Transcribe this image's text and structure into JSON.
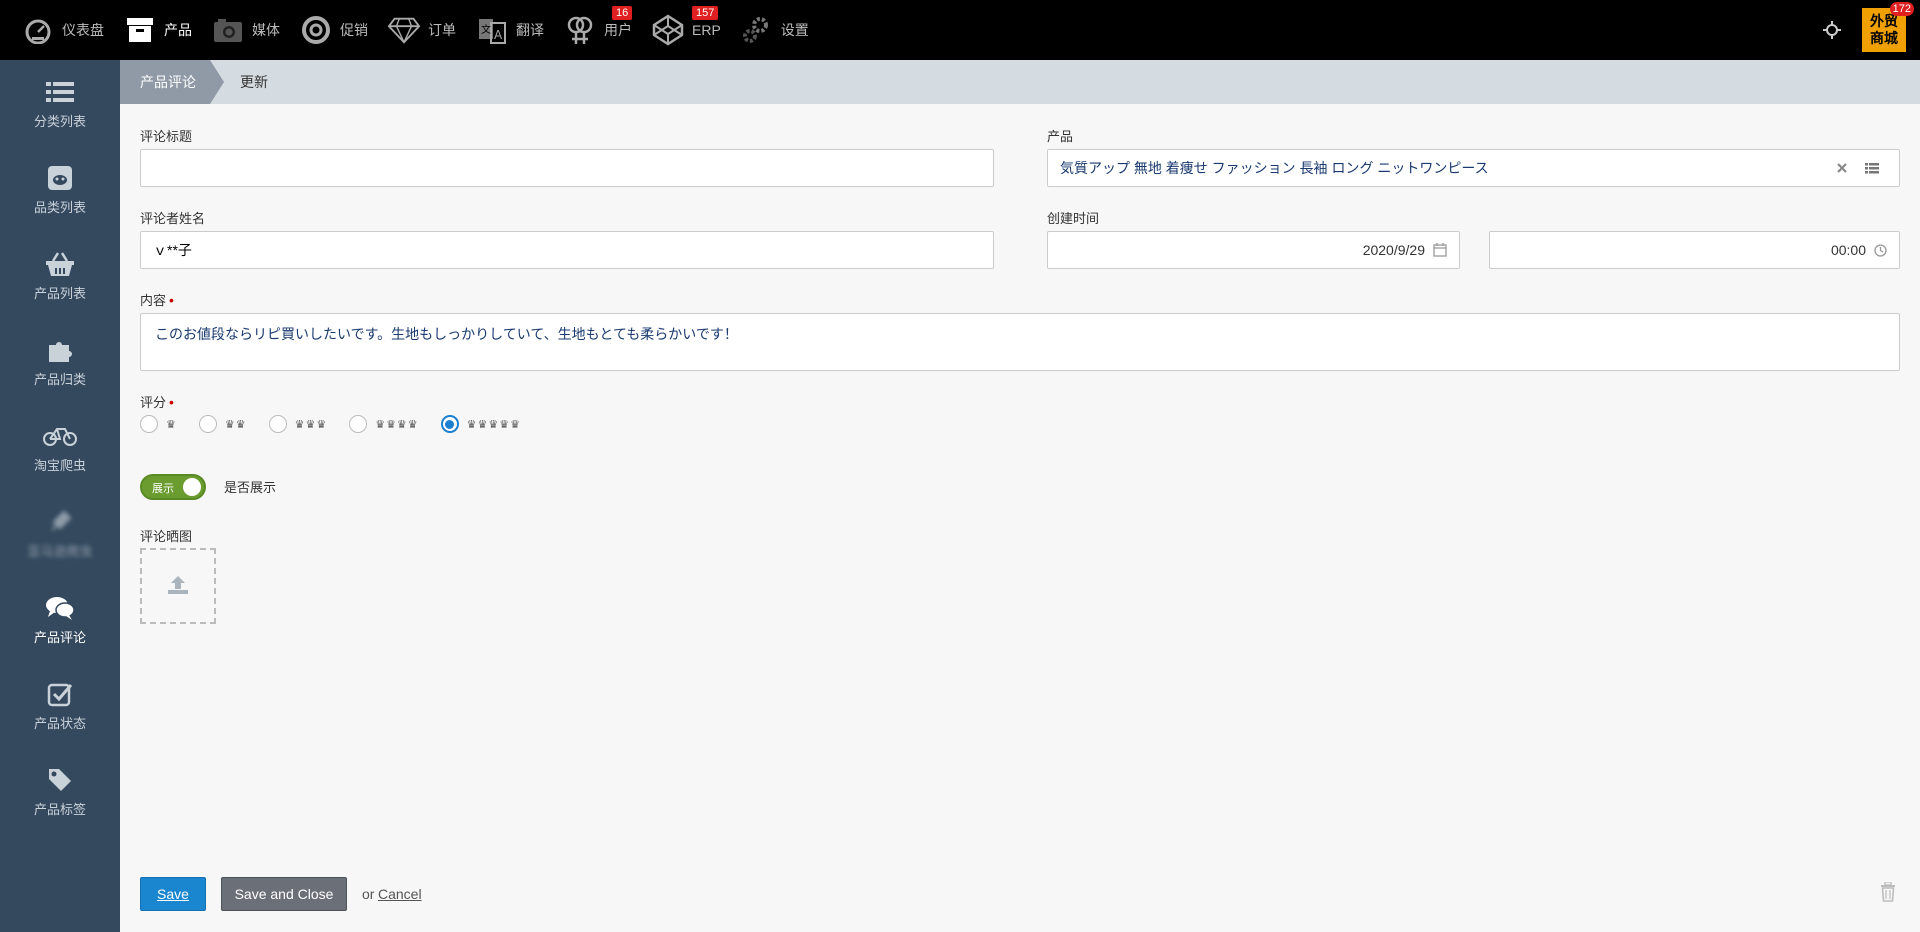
{
  "nav": {
    "items": [
      {
        "label": "仪表盘",
        "icon": "dashboard-icon"
      },
      {
        "label": "产品",
        "icon": "archive-box-icon"
      },
      {
        "label": "媒体",
        "icon": "camera-icon"
      },
      {
        "label": "促销",
        "icon": "life-ring-icon"
      },
      {
        "label": "订单",
        "icon": "diamond-icon"
      },
      {
        "label": "翻译",
        "icon": "translate-icon"
      },
      {
        "label": "用户",
        "icon": "gender-icon",
        "badge": "16"
      },
      {
        "label": "ERP",
        "icon": "codepen-icon",
        "badge": "157"
      },
      {
        "label": "设置",
        "icon": "gears-icon"
      }
    ],
    "shop": {
      "line1": "外贸",
      "line2": "商城",
      "badge": "172"
    }
  },
  "sidebar": {
    "items": [
      {
        "label": "分类列表",
        "icon": "list-icon"
      },
      {
        "label": "品类列表",
        "icon": "reddit-icon"
      },
      {
        "label": "产品列表",
        "icon": "basket-icon"
      },
      {
        "label": "产品归类",
        "icon": "puzzle-icon"
      },
      {
        "label": "淘宝爬虫",
        "icon": "bicycle-icon"
      },
      {
        "label": "亚马逊爬虫",
        "icon": "plug-icon"
      },
      {
        "label": "产品评论",
        "icon": "comments-icon"
      },
      {
        "label": "产品状态",
        "icon": "check-square-icon"
      },
      {
        "label": "产品标签",
        "icon": "tag-icon"
      }
    ]
  },
  "breadcrumb": {
    "first": "产品评论",
    "second": "更新"
  },
  "form": {
    "title_label": "评论标题",
    "title_value": "",
    "product_label": "产品",
    "product_value": "気質アップ 無地 着痩せ ファッション 長袖 ロング ニットワンピース",
    "reviewer_label": "评论者姓名",
    "reviewer_value": "ｖ**子",
    "created_label": "创建时间",
    "created_date": "2020/9/29",
    "created_time": "00:00",
    "content_label": "内容",
    "content_value": "このお値段ならリピ買いしたいです。生地もしっかりしていて、生地もとても柔らかいです！",
    "rating_label": "评分",
    "rating_options": [
      "♛",
      "♛♛",
      "♛♛♛",
      "♛♛♛♛",
      "♛♛♛♛♛"
    ],
    "rating_selected": 5,
    "toggle_on_label": "展示",
    "toggle_caption": "是否展示",
    "image_label": "评论晒图"
  },
  "actions": {
    "save": "Save",
    "save_close": "Save and Close",
    "or": "or",
    "cancel": "Cancel"
  }
}
